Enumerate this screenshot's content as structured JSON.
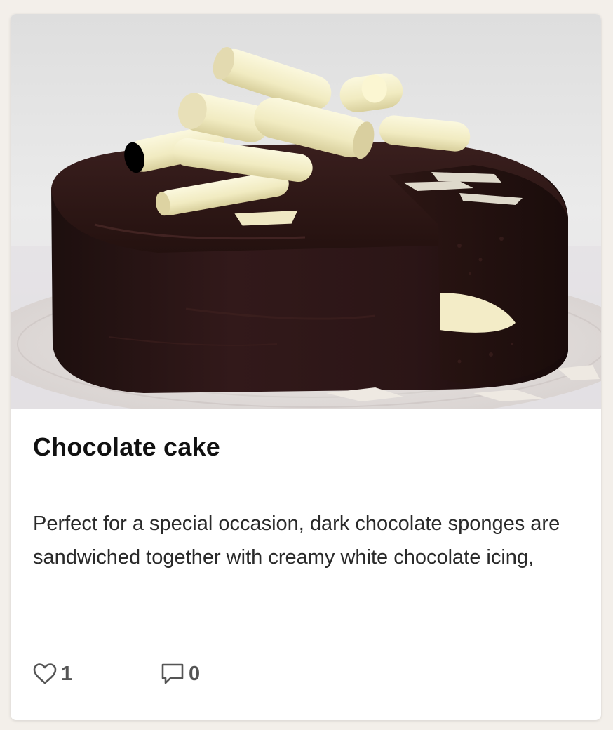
{
  "card": {
    "image": {
      "alt": "Chocolate cake",
      "accent_colors": {
        "background": "#e8e7e8",
        "icing": "#2a1614",
        "white_chocolate": "#f2edc8",
        "plate": "#dcd6d4"
      }
    },
    "title": "Chocolate cake",
    "description": "Perfect for a special occasion, dark chocolate sponges are sandwiched together with creamy white chocolate icing,",
    "actions": {
      "likes": {
        "icon": "heart-icon",
        "count": "1"
      },
      "comments": {
        "icon": "speech-bubble-icon",
        "count": "0"
      }
    }
  }
}
